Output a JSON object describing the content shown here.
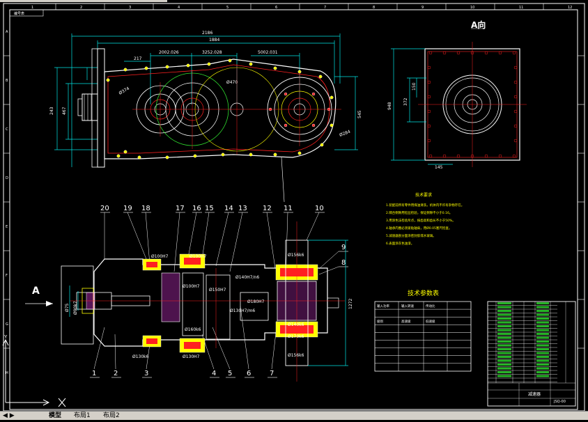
{
  "drawing": {
    "corner_label": "编号表",
    "view_label_a": "A向",
    "view_arrow_a": "A",
    "border_top_numbers": [
      "1",
      "2",
      "3",
      "4",
      "5",
      "6",
      "7",
      "8",
      "9",
      "10",
      "11",
      "12"
    ],
    "border_left_letters": [
      "A",
      "B",
      "C",
      "D",
      "E",
      "F",
      "G",
      "H"
    ],
    "dimensions": {
      "overall_length": "2186",
      "length_2": "1884",
      "d1": "217",
      "d2": "2002.026",
      "d3": "3252.028",
      "d4": "5002.031",
      "height_left": "243",
      "h_mid": "467",
      "h_right": "545",
      "av_height": "948",
      "av_dim": "372",
      "av_dim2": "150",
      "av_bottom": "145",
      "dia_left": "Ø374",
      "dia_right": "Ø284",
      "dia_mid": "Ø470"
    },
    "fits": {
      "f1": "Ø100H7",
      "f2": "Ø100H7",
      "f3": "Ø100H7",
      "f4": "Ø140H7/n6",
      "f5": "Ø130H7/m6",
      "f6": "Ø150H7",
      "f7": "Ø180H7",
      "f8": "Ø130H7",
      "f9": "Ø160k6",
      "f10": "Ø156k6",
      "f11": "Ø140k6",
      "f12": "Ø170k6",
      "f13": "Ø156k6",
      "f14": "Ø130k6",
      "left_dim": "Ø75",
      "left_dim2": "Ø90k7",
      "right_dim": "1272"
    },
    "balloons_top": [
      "20",
      "19",
      "18",
      "17",
      "16",
      "15",
      "14",
      "13",
      "12",
      "11",
      "10"
    ],
    "balloons_right": [
      "9",
      "8"
    ],
    "balloons_bottom": [
      "1",
      "2",
      "3",
      "4",
      "5",
      "6",
      "7"
    ],
    "tech_req_title": "技术要求",
    "tech_req_lines": [
      "1.装配前所有零件用煤油清洗，机体内不许有杂物存在。",
      "2.啸合侧隙用铅丝检验，保证侧隙不小于0.16。",
      "3.用涂色法检验斥点，按齿高和齿长不小于50%。",
      "4.轴承内圈必须紧贴轴肩，用Ø0.05塞尺检查。",
      "5.减速器剖分面涂密封胶或水玻璃。",
      "6.表面涂灰色油漆。"
    ],
    "tech_table_title": "技术参数表",
    "tech_table_rows": [
      [
        "输入功率",
        "输入转速",
        "传动比",
        ""
      ],
      [
        "",
        "",
        "",
        ""
      ],
      [
        "级别",
        "高速级",
        "低速级",
        ""
      ],
      [
        "",
        "",
        "",
        ""
      ],
      [
        "",
        "",
        "",
        ""
      ],
      [
        "",
        "",
        "",
        ""
      ],
      [
        "",
        "",
        "",
        ""
      ]
    ],
    "title_block_name": "减速器",
    "title_block_drawing_no": "JSQ-00"
  },
  "layout_tabs": [
    "模型",
    "布局1",
    "布局2"
  ],
  "colors": {
    "background": "#000000",
    "lines": "#ffffff",
    "cyan": "#00e5e5",
    "yellow": "#ffff00",
    "red": "#ff2020",
    "green": "#30e030",
    "magenta": "#ff40ff"
  }
}
